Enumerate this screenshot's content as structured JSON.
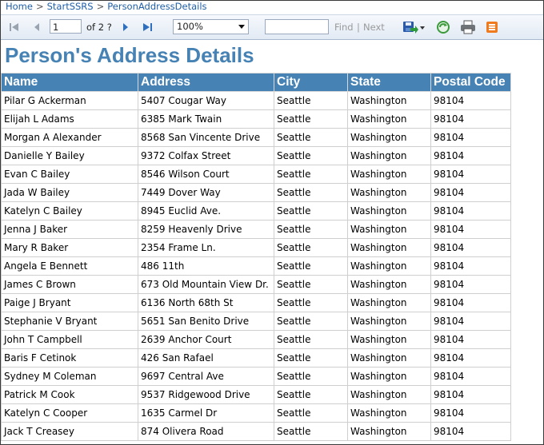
{
  "breadcrumb": [
    "Home",
    "StartSSRS",
    "PersonAddressDetails"
  ],
  "toolbar": {
    "current_page": "1",
    "of_pages": "of 2 ?",
    "zoom": "100%",
    "find_value": "",
    "find_label": "Find",
    "find_separator": "|",
    "next_label": "Next"
  },
  "report": {
    "title": "Person's Address Details",
    "columns": [
      "Name",
      "Address",
      "City",
      "State",
      "Postal Code"
    ],
    "rows": [
      [
        "Pilar G Ackerman",
        "5407 Cougar Way",
        "Seattle",
        "Washington",
        "98104"
      ],
      [
        "Elijah L Adams",
        "6385 Mark Twain",
        "Seattle",
        "Washington",
        "98104"
      ],
      [
        "Morgan A Alexander",
        "8568 San Vincente Drive",
        "Seattle",
        "Washington",
        "98104"
      ],
      [
        "Danielle Y Bailey",
        "9372 Colfax Street",
        "Seattle",
        "Washington",
        "98104"
      ],
      [
        "Evan C Bailey",
        "8546 Wilson Court",
        "Seattle",
        "Washington",
        "98104"
      ],
      [
        "Jada W Bailey",
        "7449 Dover Way",
        "Seattle",
        "Washington",
        "98104"
      ],
      [
        "Katelyn C Bailey",
        "8945 Euclid Ave.",
        "Seattle",
        "Washington",
        "98104"
      ],
      [
        "Jenna J Baker",
        "8259 Heavenly Drive",
        "Seattle",
        "Washington",
        "98104"
      ],
      [
        "Mary R Baker",
        "2354 Frame Ln.",
        "Seattle",
        "Washington",
        "98104"
      ],
      [
        "Angela E Bennett",
        "486 11th",
        "Seattle",
        "Washington",
        "98104"
      ],
      [
        "James C Brown",
        "673 Old Mountain View Dr.",
        "Seattle",
        "Washington",
        "98104"
      ],
      [
        "Paige J Bryant",
        "6136 North 68th St",
        "Seattle",
        "Washington",
        "98104"
      ],
      [
        "Stephanie V Bryant",
        "5651 San Benito Drive",
        "Seattle",
        "Washington",
        "98104"
      ],
      [
        "John T Campbell",
        "2639 Anchor Court",
        "Seattle",
        "Washington",
        "98104"
      ],
      [
        "Baris F Cetinok",
        "426 San Rafael",
        "Seattle",
        "Washington",
        "98104"
      ],
      [
        "Sydney M Coleman",
        "9697 Central Ave",
        "Seattle",
        "Washington",
        "98104"
      ],
      [
        "Patrick M Cook",
        "9537 Ridgewood Drive",
        "Seattle",
        "Washington",
        "98104"
      ],
      [
        "Katelyn C Cooper",
        "1635 Carmel Dr",
        "Seattle",
        "Washington",
        "98104"
      ],
      [
        "Jack T Creasey",
        "874 Olivera Road",
        "Seattle",
        "Washington",
        "98104"
      ]
    ]
  },
  "icons": [
    "first-page-icon",
    "previous-page-icon",
    "next-page-icon",
    "last-page-icon",
    "export-save-icon",
    "refresh-icon",
    "print-icon",
    "data-feed-icon"
  ],
  "colors": {
    "header_bg": "#4682b4",
    "title": "#4682b4",
    "link": "#1f5fa8"
  }
}
